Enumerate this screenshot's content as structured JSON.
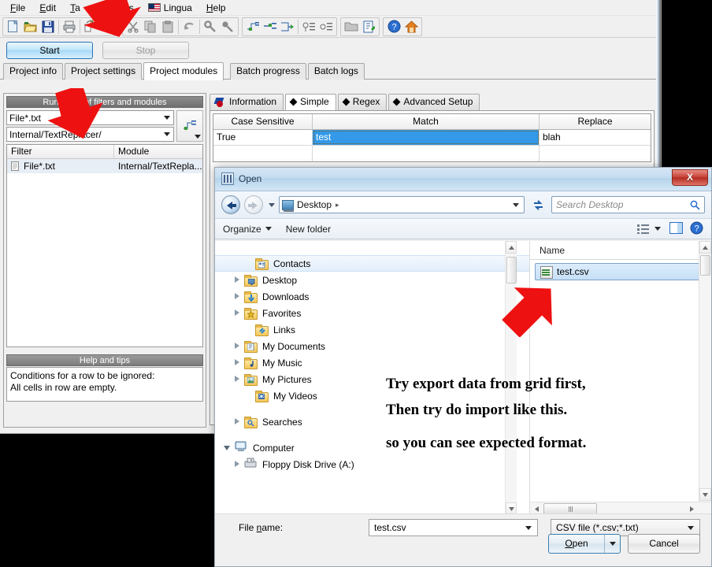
{
  "app": {
    "menu": [
      {
        "label": "File"
      },
      {
        "label": "Edit"
      },
      {
        "label": "Tables"
      },
      {
        "label": "Tools"
      },
      {
        "label": "Lingua"
      },
      {
        "label": "Help"
      }
    ],
    "toolbar_icons": [
      "new-document-icon",
      "open-folder-icon",
      "save-disk-icon",
      "print-icon",
      "import-icon",
      "export-icon",
      "cut-scissors-icon",
      "copy-icon",
      "paste-icon",
      "undo-icon",
      "find-key-icon",
      "find-next-key-icon",
      "insert-row-icon",
      "insert-row-after-icon",
      "move-row-icon",
      "filter-icon",
      "filter-alt-icon",
      "folder-icon",
      "edit-note-icon",
      "help-circle-icon",
      "home-icon"
    ],
    "run": {
      "start_label": "Start",
      "stop_label": "Stop"
    },
    "main_tabs": [
      {
        "label": "Project info",
        "active": false
      },
      {
        "label": "Project settings",
        "active": false
      },
      {
        "label": "Project modules",
        "active": true
      },
      {
        "label": "Batch progress",
        "active": false
      },
      {
        "label": "Batch logs",
        "active": false
      }
    ],
    "left_panel": {
      "header": "Run-order of filters and modules",
      "filter_combo_value": "File*.txt",
      "module_combo_value": "Internal/TextReplacer/",
      "add_button_icon": "add-row-icon",
      "columns": [
        "Filter",
        "Module"
      ],
      "rows": [
        {
          "filter": "File*.txt",
          "module": "Internal/TextRepla...",
          "icon": "document-icon"
        }
      ],
      "help_header": "Help and tips",
      "help_line1": "Conditions for a row to be ignored:",
      "help_line2": "All cells in row are empty."
    },
    "module_tabs": [
      {
        "label": "Information",
        "active": false,
        "icon": "information-icon"
      },
      {
        "label": "Simple",
        "active": true,
        "icon": "diamond-icon"
      },
      {
        "label": "Regex",
        "active": false,
        "icon": "diamond-icon"
      },
      {
        "label": "Advanced Setup",
        "active": false,
        "icon": "diamond-icon"
      }
    ],
    "match_grid": {
      "columns": [
        "Case Sensitive",
        "Match",
        "Replace"
      ],
      "rows": [
        {
          "case_sensitive": "True",
          "match": "test",
          "replace": "blah",
          "selected_cell": "match"
        }
      ]
    }
  },
  "dialog": {
    "title": "Open",
    "title_icon": "window-icon",
    "close_label": "X",
    "nav": {
      "back_icon": "back-arrow-icon",
      "forward_icon": "forward-arrow-icon",
      "history_icon": "history-dropdown-icon",
      "address_icon": "desktop-icon",
      "breadcrumb": "Desktop",
      "breadcrumb_sep": "▸",
      "refresh_icon": "refresh-icon",
      "search_placeholder": "Search Desktop",
      "search_icon": "search-icon"
    },
    "command_bar": {
      "organize_label": "Organize",
      "new_folder_label": "New folder",
      "views_icon": "views-icon",
      "preview_pane_icon": "preview-pane-icon",
      "help_icon": "help-icon"
    },
    "nav_tree": [
      {
        "label": "Contacts",
        "expander": "none",
        "indent": 36,
        "icon": "contacts-folder-icon",
        "selected": true
      },
      {
        "label": "Desktop",
        "expander": "closed",
        "indent": 22,
        "icon": "desktop-folder-icon"
      },
      {
        "label": "Downloads",
        "expander": "closed",
        "indent": 22,
        "icon": "downloads-folder-icon"
      },
      {
        "label": "Favorites",
        "expander": "closed",
        "indent": 22,
        "icon": "favorites-folder-icon"
      },
      {
        "label": "Links",
        "expander": "none",
        "indent": 36,
        "icon": "links-folder-icon"
      },
      {
        "label": "My Documents",
        "expander": "closed",
        "indent": 22,
        "icon": "documents-folder-icon"
      },
      {
        "label": "My Music",
        "expander": "closed",
        "indent": 22,
        "icon": "music-folder-icon"
      },
      {
        "label": "My Pictures",
        "expander": "closed",
        "indent": 22,
        "icon": "pictures-folder-icon"
      },
      {
        "label": "My Videos",
        "expander": "none",
        "indent": 36,
        "icon": "videos-folder-icon"
      },
      {
        "label": "",
        "expander": "none",
        "indent": 22,
        "icon": "spacer",
        "spacer": true
      },
      {
        "label": "Searches",
        "expander": "closed",
        "indent": 22,
        "icon": "searches-folder-icon"
      },
      {
        "label": "",
        "expander": "none",
        "indent": 22,
        "icon": "spacer",
        "spacer": true
      },
      {
        "label": "Computer",
        "expander": "open",
        "indent": 10,
        "icon": "computer-icon"
      },
      {
        "label": "Floppy Disk Drive (A:)",
        "expander": "closed",
        "indent": 22,
        "icon": "floppy-drive-icon"
      }
    ],
    "file_list": {
      "column": "Name",
      "files": [
        {
          "name": "test.csv",
          "icon": "csv-file-icon",
          "selected": true
        }
      ]
    },
    "footer": {
      "file_name_label": "File name:",
      "file_name_value": "test.csv",
      "file_type_value": "CSV file (*.csv;*.txt)",
      "open_label": "Open",
      "cancel_label": "Cancel"
    }
  },
  "annotations": {
    "note1_line1": "Try export data from grid first,",
    "note1_line2": "so you can see expected format.",
    "note2": "Then try do import like this.",
    "arrow_color": "#ee1111",
    "arrows": [
      {
        "name": "arrow-to-toolbar-import"
      },
      {
        "name": "arrow-to-filter-combo"
      },
      {
        "name": "arrow-to-test-csv"
      }
    ]
  }
}
